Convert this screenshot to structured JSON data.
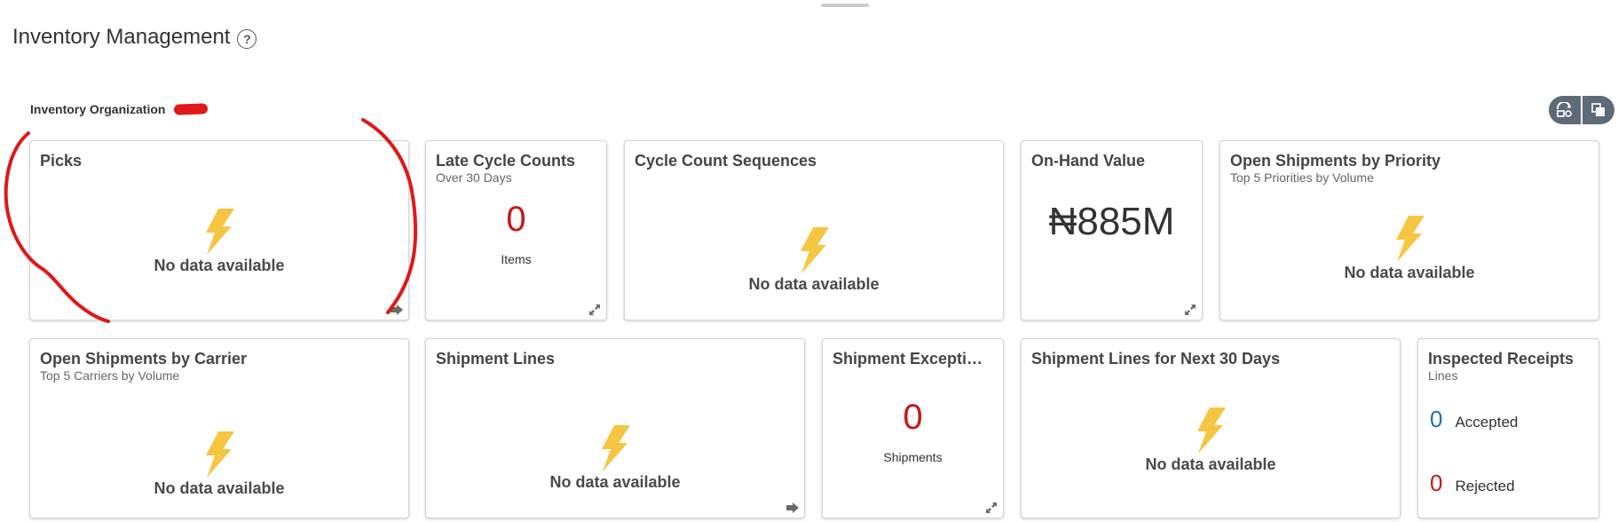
{
  "header": {
    "title": "Inventory Management",
    "help_icon": "question-circle-icon"
  },
  "organization": {
    "label": "Inventory Organization",
    "value_redacted": true
  },
  "toolbar": {
    "buttons": [
      "personalize-icon",
      "copy-layout-icon"
    ],
    "color": "#5d6b78"
  },
  "tiles": {
    "picks": {
      "title": "Picks",
      "empty_text": "No data available"
    },
    "late_cycle_counts": {
      "title": "Late Cycle Counts",
      "subtitle": "Over 30 Days",
      "value": "0",
      "caption": "Items"
    },
    "cycle_count_sequences": {
      "title": "Cycle Count Sequences",
      "empty_text": "No data available"
    },
    "on_hand_value": {
      "title": "On-Hand Value",
      "value": "₦885M"
    },
    "open_shipments_priority": {
      "title": "Open Shipments by Priority",
      "subtitle": "Top 5 Priorities by Volume",
      "empty_text": "No data available"
    },
    "open_shipments_carrier": {
      "title": "Open Shipments by Carrier",
      "subtitle": "Top 5 Carriers by Volume",
      "empty_text": "No data available"
    },
    "shipment_lines": {
      "title": "Shipment Lines",
      "empty_text": "No data available"
    },
    "shipment_exceptions": {
      "title": "Shipment Excepti…",
      "value": "0",
      "caption": "Shipments"
    },
    "shipment_lines_30": {
      "title": "Shipment Lines for Next 30 Days",
      "empty_text": "No data available"
    },
    "inspected_receipts": {
      "title": "Inspected Receipts",
      "subtitle": "Lines",
      "accepted_value": "0",
      "accepted_label": "Accepted",
      "rejected_value": "0",
      "rejected_label": "Rejected"
    }
  },
  "colors": {
    "alert_red": "#c41a1a",
    "accepted_blue": "#1f6fb6",
    "bolt_yellow": "#f6c643",
    "annotation_red": "#e01818"
  }
}
